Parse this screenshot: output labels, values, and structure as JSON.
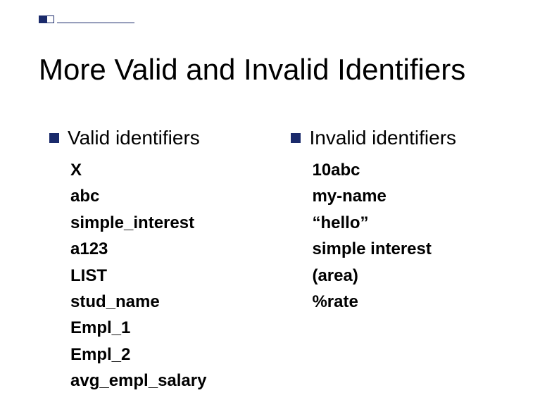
{
  "title": "More Valid and Invalid Identifiers",
  "left": {
    "heading": "Valid identifiers",
    "items": [
      "X",
      "abc",
      "simple_interest",
      "a123",
      "LIST",
      "stud_name",
      "Empl_1",
      "Empl_2",
      "avg_empl_salary"
    ]
  },
  "right": {
    "heading": "Invalid identifiers",
    "items": [
      "10abc",
      "my-name",
      "“hello”",
      "simple interest",
      "(area)",
      "%rate"
    ]
  },
  "colors": {
    "accent": "#1a2a6b"
  }
}
